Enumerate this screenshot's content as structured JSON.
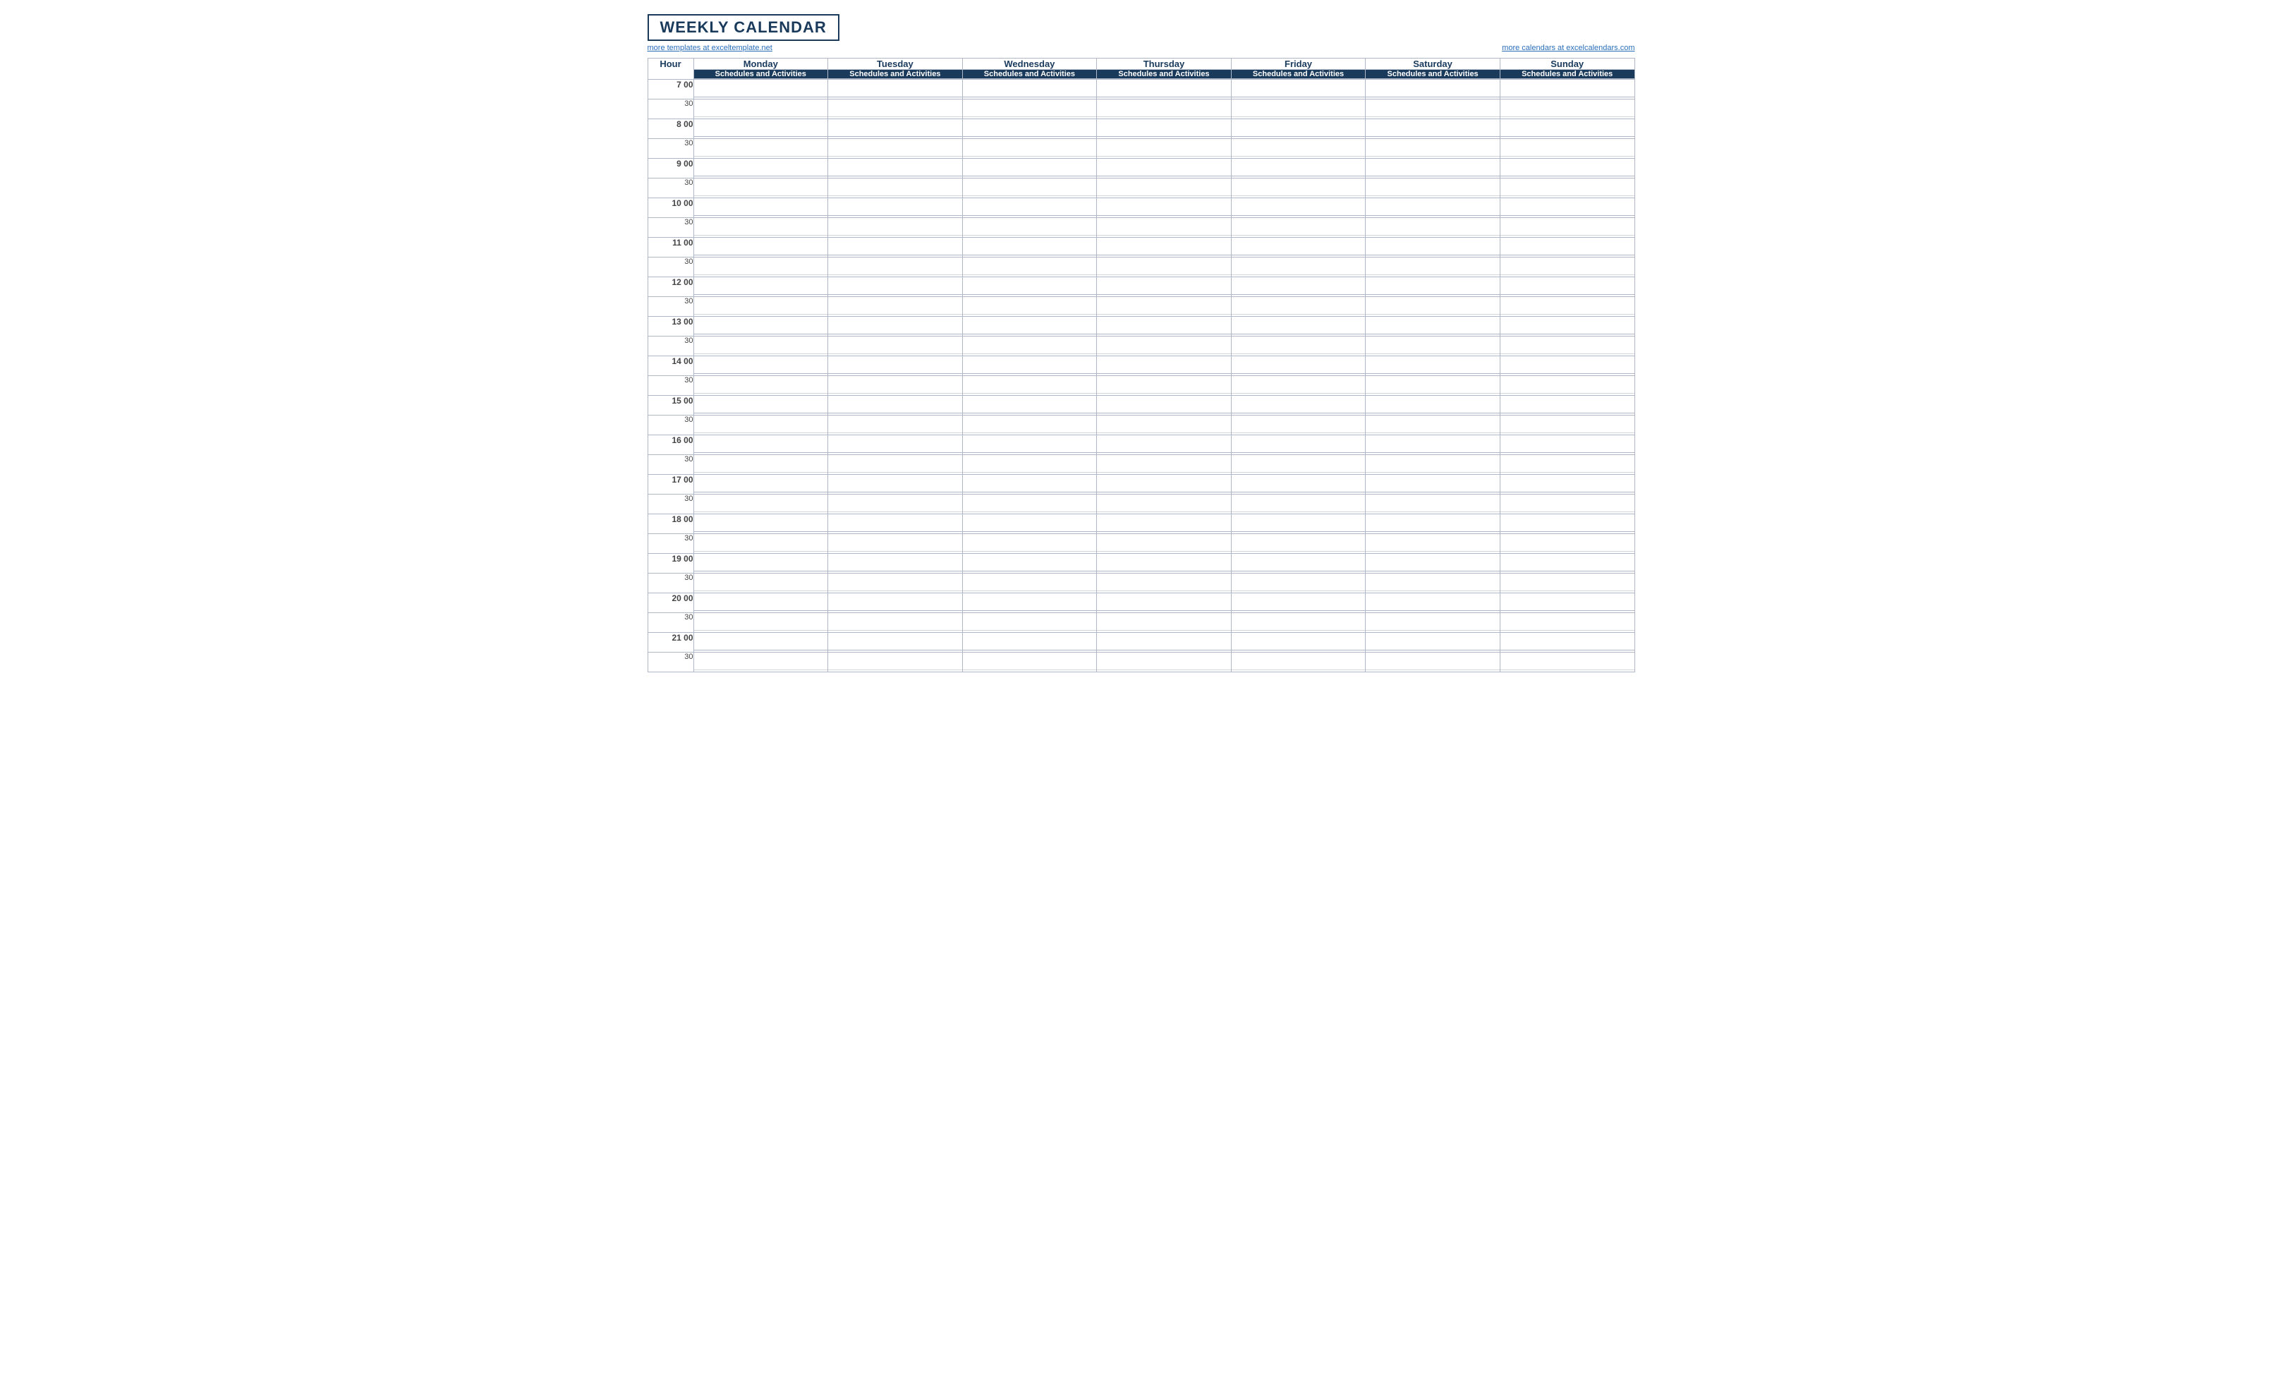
{
  "title": "WEEKLY CALENDAR",
  "link_left": "more templates at exceltemplate.net",
  "link_right": "more calendars at excelcalendars.com",
  "header": {
    "hour_label": "Hour",
    "days": [
      "Monday",
      "Tuesday",
      "Wednesday",
      "Thursday",
      "Friday",
      "Saturday",
      "Sunday"
    ],
    "sub_label": "Schedules and Activities"
  },
  "hours": [
    {
      "hour": "7  00",
      "half": "30"
    },
    {
      "hour": "8  00",
      "half": "30"
    },
    {
      "hour": "9  00",
      "half": "30"
    },
    {
      "hour": "10  00",
      "half": "30"
    },
    {
      "hour": "11  00",
      "half": "30"
    },
    {
      "hour": "12  00",
      "half": "30"
    },
    {
      "hour": "13  00",
      "half": "30"
    },
    {
      "hour": "14  00",
      "half": "30"
    },
    {
      "hour": "15  00",
      "half": "30"
    },
    {
      "hour": "16  00",
      "half": "30"
    },
    {
      "hour": "17  00",
      "half": "30"
    },
    {
      "hour": "18  00",
      "half": "30"
    },
    {
      "hour": "19  00",
      "half": "30"
    },
    {
      "hour": "20  00",
      "half": "30"
    },
    {
      "hour": "21  00",
      "half": "30"
    }
  ]
}
